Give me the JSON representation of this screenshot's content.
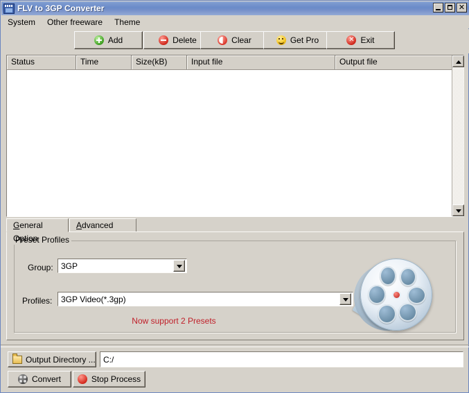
{
  "window": {
    "title": "FLV to 3GP Converter",
    "app_icon": "film-clapper-icon",
    "minimize_label": "",
    "maximize_label": "",
    "close_label": "✕"
  },
  "menu": [
    {
      "label": "System"
    },
    {
      "label": "Other freeware"
    },
    {
      "label": "Theme"
    }
  ],
  "toolbar": [
    {
      "label": "Add",
      "icon": "green-plus-icon"
    },
    {
      "label": "Delete",
      "icon": "red-minus-icon"
    },
    {
      "label": "Clear",
      "icon": "red-clear-icon"
    },
    {
      "label": "Get Pro",
      "icon": "yellow-smiley-icon"
    },
    {
      "label": "Exit",
      "icon": "red-x-icon"
    }
  ],
  "file_list": {
    "columns": [
      "Status",
      "Time",
      "Size(kB)",
      "Input file",
      "Output file"
    ],
    "rows": []
  },
  "tabs": [
    {
      "label": "General Option",
      "mnemonic": "G",
      "active": true
    },
    {
      "label": "Advanced Option",
      "mnemonic": "A",
      "active": false
    }
  ],
  "general_option": {
    "group_title": "Preset Profiles",
    "group_label": "Group:",
    "group_value": "3GP",
    "profiles_label": "Profiles:",
    "profiles_value": "3GP Video(*.3gp)",
    "notice": "Now support 2 Presets",
    "notice_color": "#c0202a",
    "decoration": "film-reel-image"
  },
  "output": {
    "button_label": "Output Directory ...",
    "path_value": "C:/"
  },
  "actions": [
    {
      "label": "Convert",
      "icon": "film-reel-dark-icon"
    },
    {
      "label": "Stop Process",
      "icon": "red-stop-icon"
    }
  ]
}
